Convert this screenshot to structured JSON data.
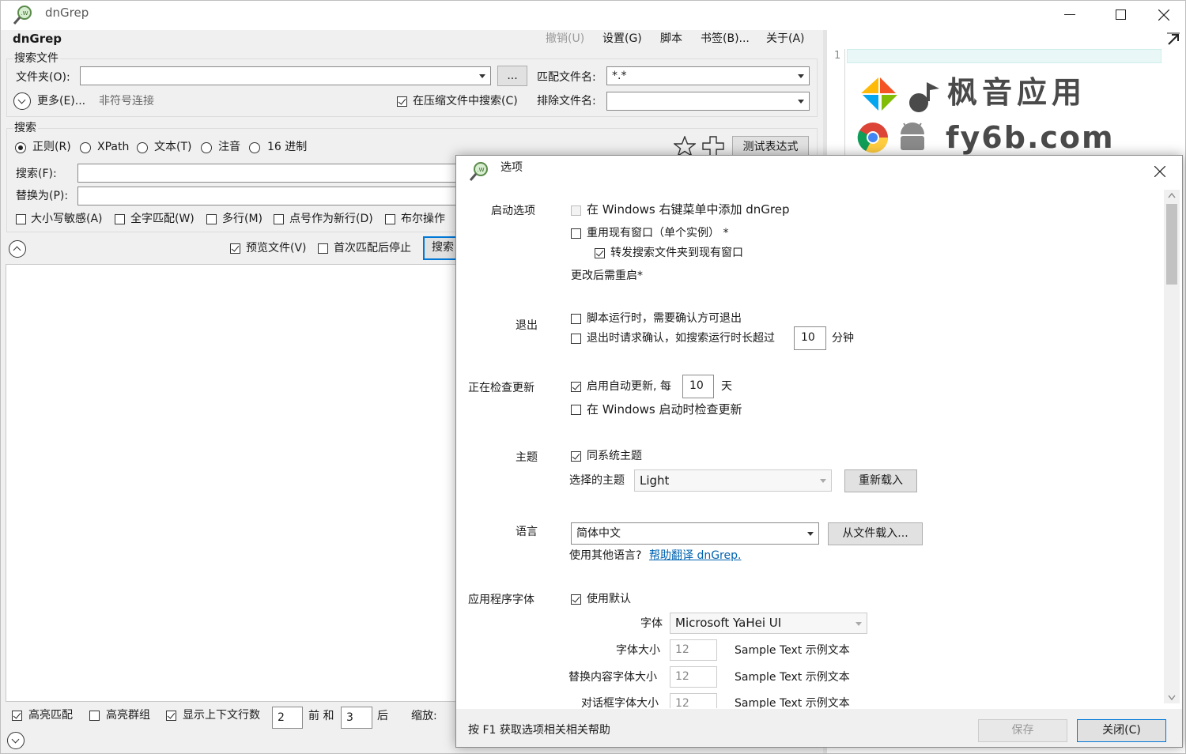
{
  "window": {
    "title": "dnGrep",
    "app_name": "dnGrep"
  },
  "menu": {
    "undo": "撤销(U)",
    "settings": "设置(G)",
    "script": "脚本",
    "bookmarks": "书签(B)...",
    "about": "关于(A)"
  },
  "search_files": {
    "group_label": "搜索文件",
    "folder_label": "文件夹(O):",
    "folder_value": "",
    "browse_label": "...",
    "match_file_label": "匹配文件名:",
    "match_file_value": "*.*",
    "more_label": "更多(E)...",
    "symlink_label": "非符号连接",
    "search_archives_label": "在压缩文件中搜索(C)",
    "exclude_label": "排除文件名:",
    "exclude_value": ""
  },
  "search": {
    "group_label": "搜索",
    "modes": [
      "正则(R)",
      "XPath",
      "文本(T)",
      "注音",
      "16 进制"
    ],
    "test_expression_label": "测试表达式",
    "search_label": "搜索(F):",
    "search_value": "",
    "replace_label": "替换为(P):",
    "replace_value": "",
    "options": [
      "大小写敏感(A)",
      "全字匹配(W)",
      "多行(M)",
      "点号作为新行(D)",
      "布尔操作"
    ],
    "preview_label": "预览文件(V)",
    "stop_first_label": "首次匹配后停止",
    "search_button": "搜索"
  },
  "bottom": {
    "highlight_matches": "高亮匹配",
    "highlight_groups": "高亮群组",
    "show_context": "显示上下文行数",
    "before_value": "2",
    "before_label": "前 和",
    "after_value": "3",
    "after_label": "后",
    "zoom_label": "缩放:"
  },
  "preview": {
    "line_number": "1",
    "watermark_cn": "枫音应用",
    "watermark_en": "fy6b.com"
  },
  "dialog": {
    "title": "选项",
    "startup": {
      "label": "启动选项",
      "shell_menu": "在 Windows 右键菜单中添加 dnGrep",
      "reuse_window": "重用现有窗口（单个实例） *",
      "forward_folder": "转发搜索文件夹到现有窗口",
      "restart_note": "更改后需重启*"
    },
    "exit": {
      "label": "退出",
      "confirm_script": "脚本运行时，需要确认方可退出",
      "confirm_long": "退出时请求确认，如搜索运行时长超过",
      "minutes_value": "10",
      "minutes_label": "分钟"
    },
    "update": {
      "label": "正在检查更新",
      "auto_update": "启用自动更新, 每",
      "days_value": "10",
      "days_label": "天",
      "check_startup": "在 Windows 启动时检查更新"
    },
    "theme": {
      "label": "主题",
      "follow_system": "同系统主题",
      "selected_label": "选择的主题",
      "selected_value": "Light",
      "reload_button": "重新载入"
    },
    "language": {
      "label": "语言",
      "value": "简体中文",
      "load_file_button": "从文件载入...",
      "other_prefix": "使用其他语言?",
      "help_link": "帮助翻译 dnGrep."
    },
    "font": {
      "label": "应用程序字体",
      "use_default": "使用默认",
      "font_label": "字体",
      "font_value": "Microsoft YaHei UI",
      "size_label": "字体大小",
      "size_value": "12",
      "replace_size_label": "替换内容字体大小",
      "replace_size_value": "12",
      "dialog_size_label": "对话框字体大小",
      "dialog_size_value": "12",
      "sample": "Sample Text 示例文本"
    },
    "footer": {
      "help_text": "按 F1 获取选项相关相关帮助",
      "save_button": "保存",
      "close_button": "关闭(C)"
    }
  }
}
